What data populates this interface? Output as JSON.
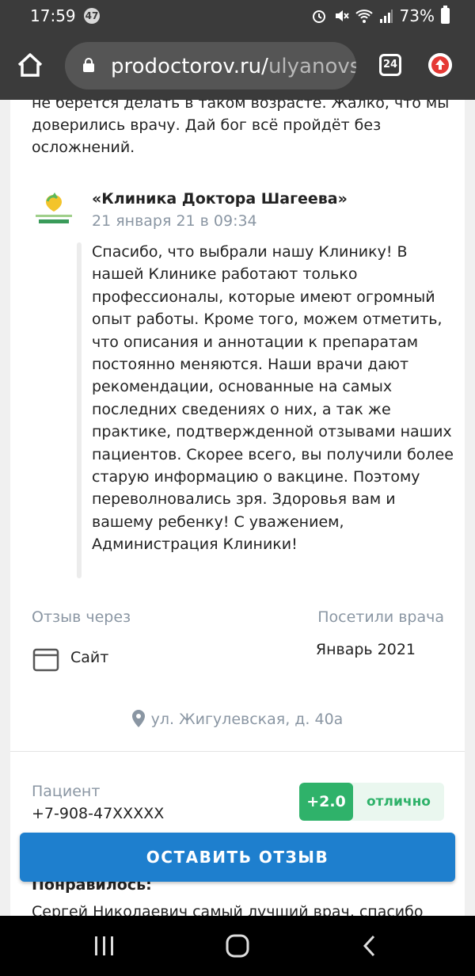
{
  "status_bar": {
    "time": "17:59",
    "notification_count": "47",
    "battery": "73%"
  },
  "browser": {
    "url_main": "prodoctorov.ru/",
    "url_rest": "ulyanovs",
    "tab_count": "24"
  },
  "review": {
    "previous_text": "не берется делать в таком возрасте. Жалко, что мы доверились врачу. Дай бог всё пройдёт без осложнений.",
    "reply": {
      "author": "«Клиника Доктора Шагеева»",
      "date": "21 января 21 в 09:34",
      "text": "Спасибо, что выбрали нашу Клинику! В нашей Клинике работают только профессионалы, которые имеют огромный опыт работы. Кроме того, можем отметить, что описания и аннотации к препаратам постоянно меняются. Наши врачи дают рекомендации, основанные на самых последних сведениях о них, а так же практике, подтвержденной отзывами наших пациентов. Скорее всего, вы получили более старую информацию о вакцине. Поэтому переволновались зря. Здоровья вам и вашему ребенку! С уважением, Администрация Клиники!"
    },
    "via_label": "Отзыв через",
    "via_value": "Сайт",
    "visit_label": "Посетили врача",
    "visit_value": "Январь 2021",
    "address": "ул. Жигулевская, д. 40а"
  },
  "next_review": {
    "patient_label": "Пациент",
    "patient_phone": "+7-908-47XXXXX",
    "rating_score": "+2.0",
    "rating_word": "отлично",
    "liked_label": "Понравилось:",
    "liked_text": "Сергей Николаевич самый лучший врач, спасибо"
  },
  "cta_button": "ОСТАВИТЬ ОТЗЫВ",
  "colors": {
    "accent": "#1e7fce",
    "rating_green": "#2fb26a",
    "muted": "#8a96a3"
  }
}
